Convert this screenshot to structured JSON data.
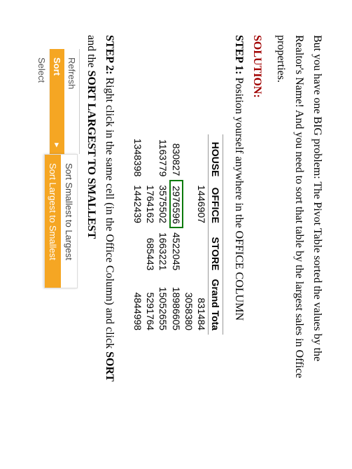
{
  "intro": {
    "line1": "But you have one BIG problem: The Pivot Table sorted the values by the",
    "line2": "Realtor's Name! And you need to sort that table by the largest sales in Office",
    "line3": "properties."
  },
  "solution_label": "SOLUTION:",
  "step1": {
    "label": "STEP 1: ",
    "text": "Position yourself anywhere in the OFFICE COLUMN"
  },
  "table": {
    "headers": [
      "HOUSE",
      "OFFICE",
      "STORE",
      "Grand Tota"
    ],
    "rows": [
      [
        "",
        "1446907",
        "",
        "831484"
      ],
      [
        "",
        "",
        "",
        "3058380"
      ],
      [
        "830827",
        "2976596",
        "4522045",
        "18986605"
      ],
      [
        "1163779",
        "3575502",
        "1663221",
        "15052655"
      ],
      [
        "",
        "1764162",
        "685443",
        "5291764"
      ],
      [
        "1348398",
        "1442439",
        "",
        "4844998"
      ]
    ],
    "highlight": {
      "row": 2,
      "col": 1
    }
  },
  "step2": {
    "label": "STEP 2: ",
    "text_a": "Right click in the same cell (in the Office Column) and click ",
    "sort": "SORT",
    "text_b": "and the ",
    "opt": "SORT LARGEST TO SMALLEST"
  },
  "menu": {
    "refresh": "Refresh",
    "sort": "Sort",
    "select": "Select",
    "arrow": "▸",
    "sub1": "Sort Smallest to Largest",
    "sub2": "Sort Largest to Smallest"
  }
}
